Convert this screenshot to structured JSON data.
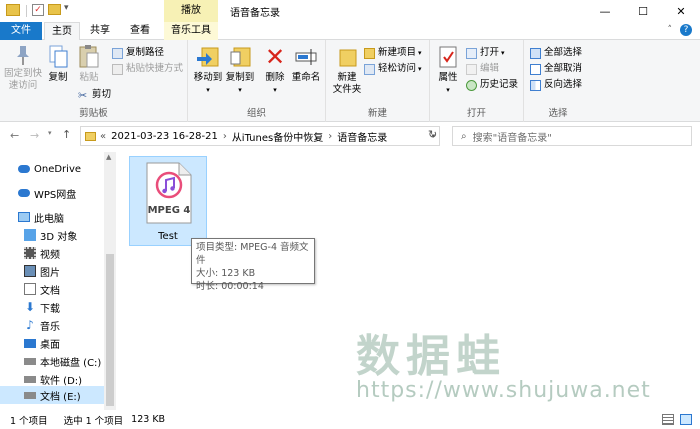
{
  "titlebar": {
    "context_tab_header": "播放",
    "title": "语音备忘录",
    "minimize": "—",
    "maximize": "☐",
    "close": "✕"
  },
  "tabs": {
    "file": "文件",
    "home": "主页",
    "share": "共享",
    "view": "查看",
    "music": "音乐工具"
  },
  "ribbon": {
    "clipboard": {
      "label": "剪贴板",
      "pin": "固定到快\n速访问",
      "pin_line1": "固定到快",
      "pin_line2": "速访问",
      "copy": "复制",
      "paste": "粘贴",
      "copy_path": "复制路径",
      "paste_shortcut": "粘贴快捷方式",
      "cut": "剪切"
    },
    "organize": {
      "label": "组织",
      "move_to": "移动到",
      "copy_to": "复制到",
      "delete": "删除",
      "rename": "重命名"
    },
    "new": {
      "label": "新建",
      "new_folder_line1": "新建",
      "new_folder_line2": "文件夹",
      "new_item": "新建项目",
      "easy_access": "轻松访问"
    },
    "open": {
      "label": "打开",
      "properties": "属性",
      "open": "打开",
      "edit": "编辑",
      "history": "历史记录"
    },
    "select": {
      "label": "选择",
      "select_all": "全部选择",
      "select_none": "全部取消",
      "invert": "反向选择"
    }
  },
  "address": {
    "crumbs": [
      "2021-03-23 16-28-21",
      "从iTunes备份中恢复",
      "语音备忘录"
    ],
    "search_placeholder": "搜索\"语音备忘录\""
  },
  "nav": {
    "items": [
      "OneDrive",
      "WPS网盘",
      "此电脑",
      "3D 对象",
      "视频",
      "图片",
      "文档",
      "下载",
      "音乐",
      "桌面",
      "本地磁盘 (C:)",
      "软件 (D:)",
      "文档 (E:)"
    ]
  },
  "file": {
    "icon_text": "MPEG 4",
    "name": "Test"
  },
  "tooltip": {
    "line1": "项目类型: MPEG-4 音频文件",
    "line2": "大小: 123 KB",
    "line3": "时长: 00:00:14"
  },
  "watermark": {
    "cn": "数据蛙",
    "url": "https://www.shujuwa.net"
  },
  "status": {
    "count": "1 个项目",
    "selected": "选中 1 个项目",
    "size": "123 KB"
  },
  "colors": {
    "accent": "#1979ca",
    "selection": "#cce8ff",
    "context_tab": "#f7f1b5"
  }
}
